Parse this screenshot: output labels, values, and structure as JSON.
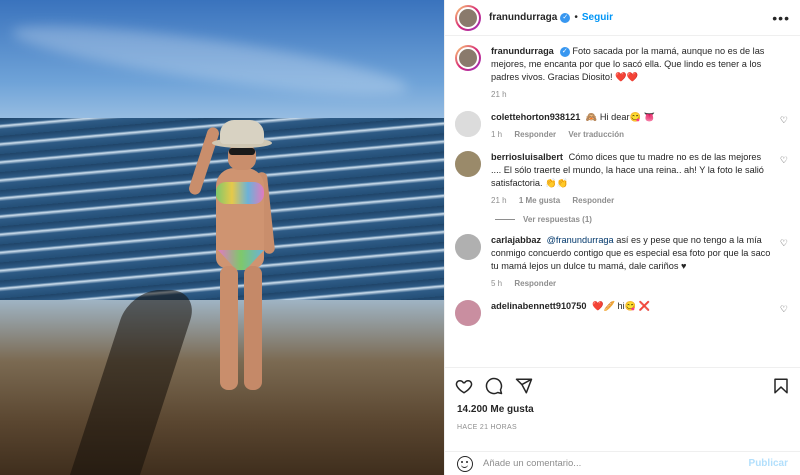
{
  "header": {
    "username": "franundurraga",
    "follow_label": "Seguir",
    "more_icon": "more-options-icon"
  },
  "caption": {
    "username": "franundurraga",
    "text": "Foto sacada por la mamá, aunque no es de las mejores, me encanta por que lo sacó ella. Que lindo es tener a los padres vivos. Gracias Diosito! ❤️❤️",
    "time": "21 h"
  },
  "comments": [
    {
      "username": "colettehorton938121",
      "text": "🙈 Hi dear😋 👅",
      "time": "1 h",
      "reply_label": "Responder",
      "translate_label": "Ver traducción"
    },
    {
      "username": "berriosluisalbert",
      "text": "Cómo dices que tu madre no es de las mejores .... El sólo traerte el mundo, la hace una reina.. ah! Y la foto le salió satisfactoria. 👏👏",
      "time": "21 h",
      "likes_label": "1 Me gusta",
      "reply_label": "Responder",
      "view_replies": "Ver respuestas (1)"
    },
    {
      "username": "carlajabbaz",
      "mention": "@franundurraga",
      "text": "así es y pese que no tengo a la mía conmigo concuerdo contigo que es especial esa foto por que la saco tu mamá lejos un dulce tu mamá, dale cariños ♥",
      "time": "5 h",
      "reply_label": "Responder"
    },
    {
      "username": "adelinabennett910750",
      "text": "❤️🥖 hi😋 ❌"
    }
  ],
  "footer": {
    "likes": "14.200 Me gusta",
    "time_ago": "HACE 21 HORAS",
    "comment_placeholder": "Añade un comentario...",
    "publish_label": "Publicar"
  },
  "colors": {
    "accent": "#0095f6",
    "verified": "#3897f0",
    "publish_disabled": "#b2dffc",
    "muted": "#8e8e8e"
  }
}
